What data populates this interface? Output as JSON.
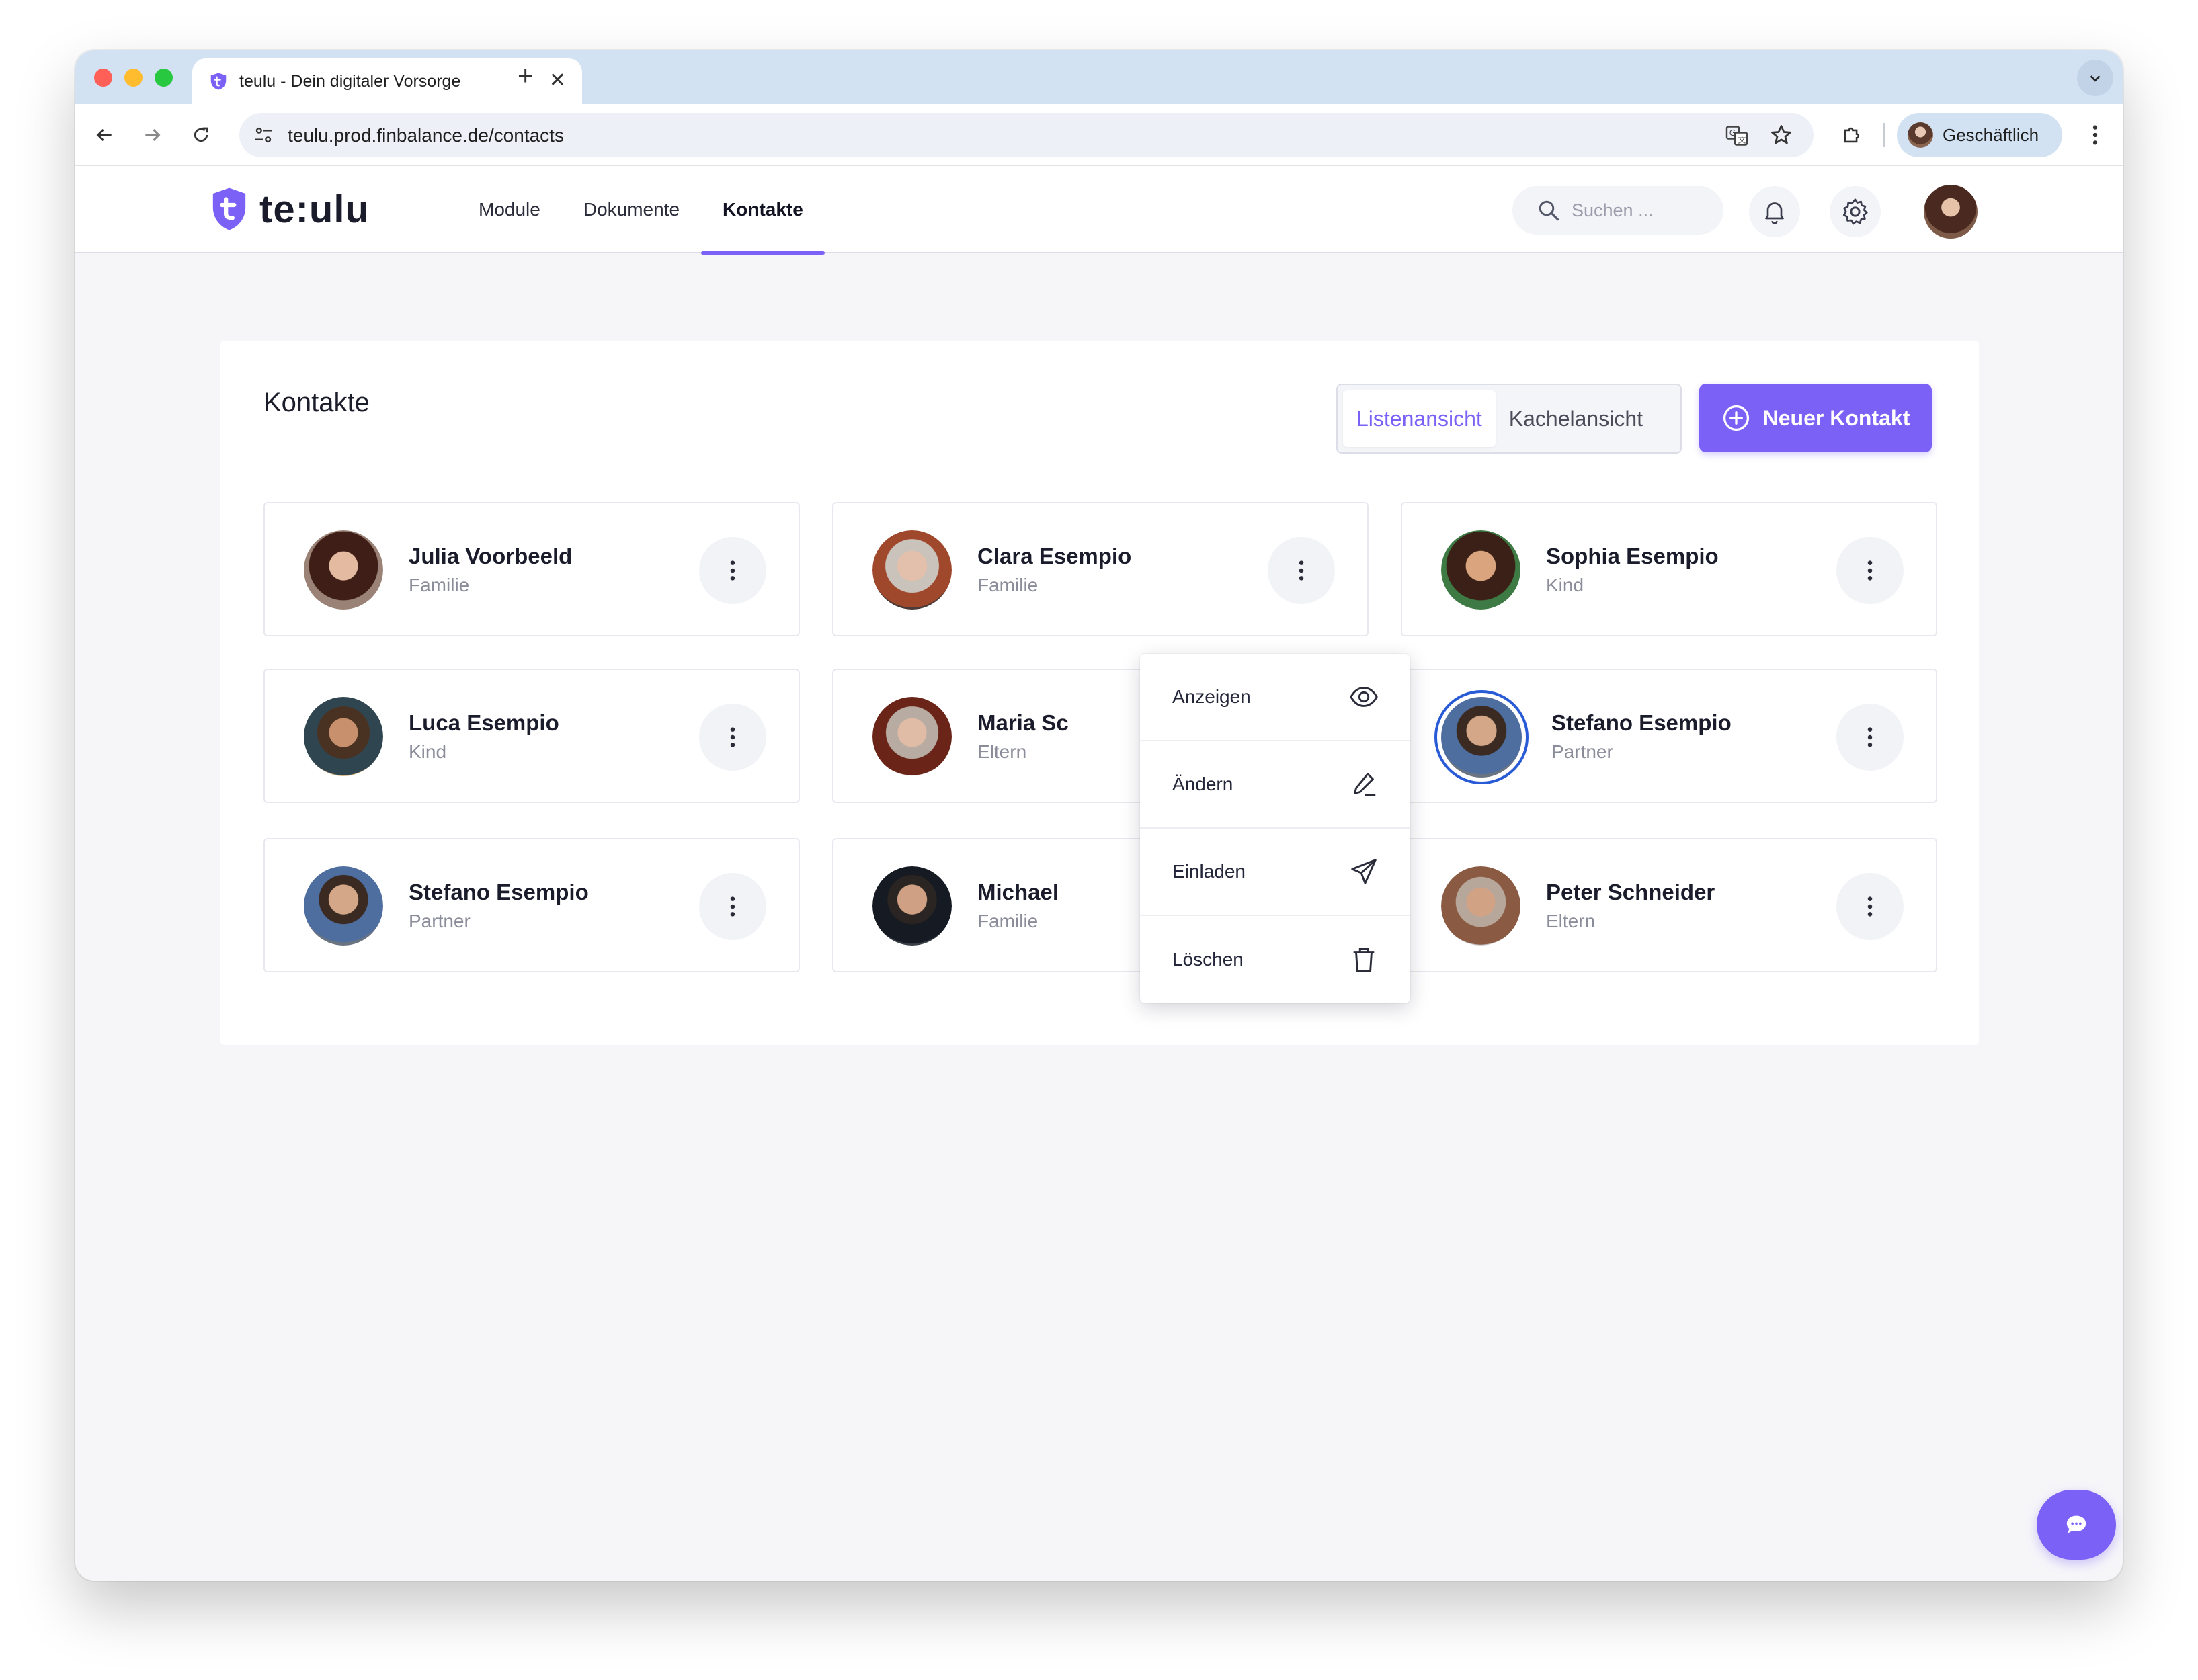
{
  "browser": {
    "tab_title": "teulu - Dein digitaler Vorsorge",
    "url": "teulu.prod.finbalance.de/contacts",
    "profile_name": "Geschäftlich"
  },
  "app": {
    "logo_text": "te:ulu",
    "nav": [
      "Module",
      "Dokumente",
      "Kontakte"
    ],
    "active_nav": "Kontakte",
    "search_placeholder": "Suchen ...",
    "accent_color": "#7b61f5"
  },
  "page": {
    "title": "Kontakte",
    "view_toggle": {
      "list": "Listenansicht",
      "tiles": "Kachelansicht",
      "active": "Listenansicht"
    },
    "new_contact_label": "Neuer Kontakt"
  },
  "contacts": [
    {
      "name": "Julia Voorbeeld",
      "relation": "Familie"
    },
    {
      "name": "Clara Esempio",
      "relation": "Familie"
    },
    {
      "name": "Sophia Esempio",
      "relation": "Kind"
    },
    {
      "name": "Luca Esempio",
      "relation": "Kind"
    },
    {
      "name": "Maria Sc",
      "relation": "Eltern"
    },
    {
      "name": "Stefano Esempio",
      "relation": "Partner",
      "highlighted": true
    },
    {
      "name": "Stefano Esempio",
      "relation": "Partner"
    },
    {
      "name": "Michael",
      "relation": "Familie"
    },
    {
      "name": "Peter Schneider",
      "relation": "Eltern"
    }
  ],
  "context_menu": {
    "open_for": "Clara Esempio",
    "items": [
      {
        "label": "Anzeigen",
        "icon": "eye-icon"
      },
      {
        "label": "Ändern",
        "icon": "pencil-icon"
      },
      {
        "label": "Einladen",
        "icon": "send-icon"
      },
      {
        "label": "Löschen",
        "icon": "trash-icon"
      }
    ]
  }
}
